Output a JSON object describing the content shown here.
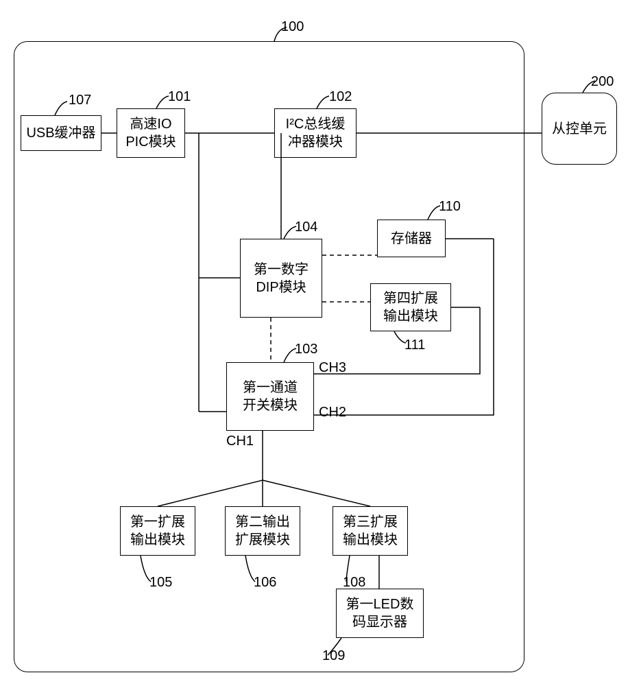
{
  "refs": {
    "r100": "100",
    "r200": "200",
    "r101": "101",
    "r102": "102",
    "r103": "103",
    "r104": "104",
    "r105": "105",
    "r106": "106",
    "r107": "107",
    "r108": "108",
    "r109": "109",
    "r110": "110",
    "r111": "111"
  },
  "nodes": {
    "b107_l1": "USB缓冲器",
    "b101_l1": "高速IO",
    "b101_l2": "PIC模块",
    "b102_l1": "I²C总线缓",
    "b102_l2": "冲器模块",
    "b200_l1": "从控单元",
    "b104_l1": "第一数字",
    "b104_l2": "DIP模块",
    "b110_l1": "存储器",
    "b111_l1": "第四扩展",
    "b111_l2": "输出模块",
    "b103_l1": "第一通道",
    "b103_l2": "开关模块",
    "b105_l1": "第一扩展",
    "b105_l2": "输出模块",
    "b106_l1": "第二输出",
    "b106_l2": "扩展模块",
    "b108_l1": "第三扩展",
    "b108_l2": "输出模块",
    "b109_l1": "第一LED数",
    "b109_l2": "码显示器"
  },
  "channels": {
    "ch1": "CH1",
    "ch2": "CH2",
    "ch3": "CH3"
  }
}
